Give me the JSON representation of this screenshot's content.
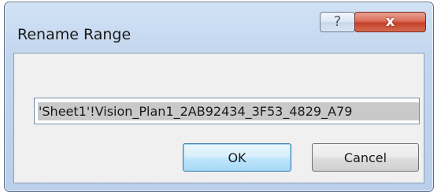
{
  "window": {
    "title": "Rename Range"
  },
  "title_buttons": {
    "help_label": "?",
    "close_label": "x"
  },
  "range_field": {
    "value": "'Sheet1'!Vision_Plan1_2AB92434_3F53_4829_A79"
  },
  "buttons": {
    "ok_label": "OK",
    "cancel_label": "Cancel"
  },
  "colors": {
    "frame": "#c2d6ee",
    "close_button": "#c4402a",
    "default_button_border": "#3c7fb1",
    "selection": "#c9c9c9"
  },
  "icons": [
    "help-icon",
    "close-icon"
  ]
}
